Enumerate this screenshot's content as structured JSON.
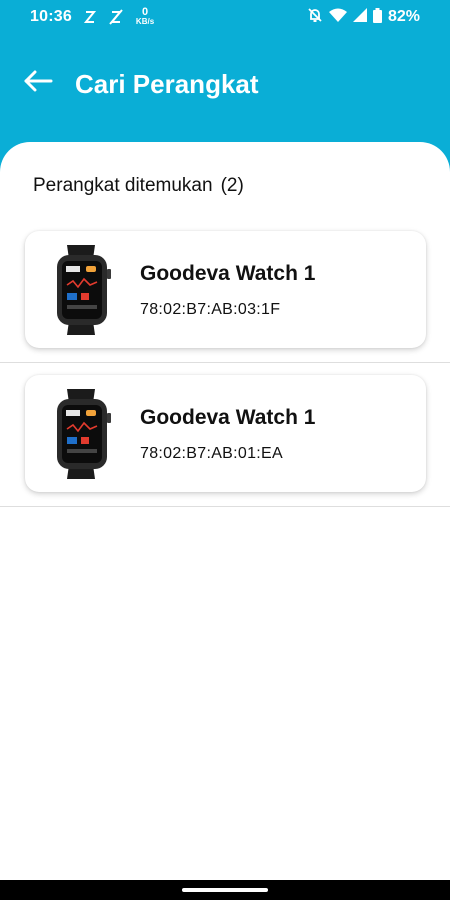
{
  "status_bar": {
    "time": "10:36",
    "net_speed_value": "0",
    "net_speed_unit": "KB/s",
    "battery": "82%"
  },
  "app_bar": {
    "title": "Cari Perangkat",
    "back_icon": "arrow-left-icon"
  },
  "found_section": {
    "label": "Perangkat ditemukan",
    "count": "(2)"
  },
  "devices": [
    {
      "name": "Goodeva Watch 1",
      "mac": "78:02:B7:AB:03:1F",
      "image": "smartwatch-image"
    },
    {
      "name": "Goodeva Watch 1",
      "mac": "78:02:B7:AB:01:EA",
      "image": "smartwatch-image"
    }
  ],
  "colors": {
    "header": "#0aaed6",
    "background": "#ffffff",
    "text": "#111111"
  }
}
